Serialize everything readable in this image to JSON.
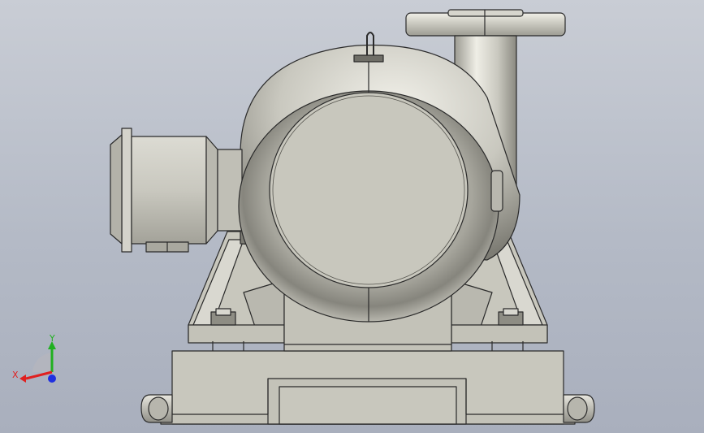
{
  "viewport": {
    "background_top": "#c9cdd5",
    "background_bottom": "#a9afbd"
  },
  "triad": {
    "x_label": "X",
    "y_label": "Y",
    "x_color": "#e02020",
    "y_color": "#20b020",
    "z_color": "#2030e0"
  },
  "model": {
    "body_color": "#c8c7bd",
    "shade_color": "#8e8d84",
    "edge_color": "#2a2a2a"
  }
}
